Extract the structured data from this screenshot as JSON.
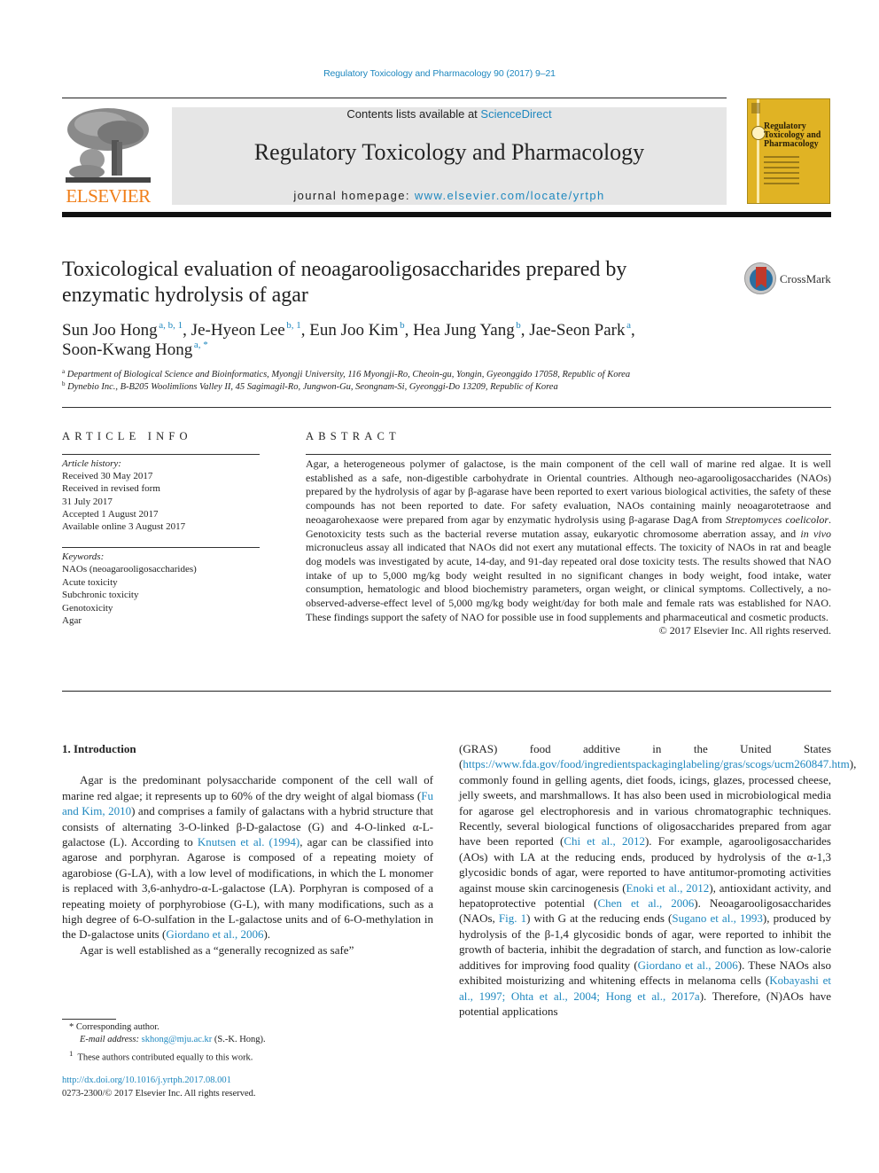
{
  "running_head": "Regulatory Toxicology and Pharmacology 90 (2017) 9–21",
  "header": {
    "publisher": "ELSEVIER",
    "contents_prefix": "Contents lists available at ",
    "contents_link": "ScienceDirect",
    "journal_name": "Regulatory Toxicology and Pharmacology",
    "homepage_prefix": "journal homepage: ",
    "homepage_link": "www.elsevier.com/locate/yrtph",
    "cover_title_lines": [
      "Regulatory",
      "Toxicology and",
      "Pharmacology"
    ],
    "cover_color": "#e0b324"
  },
  "crossmark": {
    "label": "CrossMark",
    "icon": "crossmark-icon"
  },
  "article": {
    "title": "Toxicological evaluation of neoagarooligosaccharides prepared by enzymatic hydrolysis of agar",
    "authors": [
      {
        "name": "Sun Joo Hong",
        "sup": "a, b, 1",
        "sep": ", "
      },
      {
        "name": "Je-Hyeon Lee",
        "sup": "b, 1",
        "sep": ", "
      },
      {
        "name": "Eun Joo Kim",
        "sup": "b",
        "sep": ", "
      },
      {
        "name": "Hea Jung Yang",
        "sup": "b",
        "sep": ", "
      },
      {
        "name": "Jae-Seon Park",
        "sup": "a",
        "sep": ","
      },
      {
        "name": "Soon-Kwang Hong",
        "sup": "a, *",
        "sep": ""
      }
    ],
    "affiliations": [
      {
        "key": "a",
        "text": "Department of Biological Science and Bioinformatics, Myongji University, 116 Myongji-Ro, Cheoin-gu, Yongin, Gyeonggido 17058, Republic of Korea"
      },
      {
        "key": "b",
        "text": "Dynebio Inc., B-B205 Woolimlions Valley II, 45 Sagimagil-Ro, Jungwon-Gu, Seongnam-Si, Gyeonggi-Do 13209, Republic of Korea"
      }
    ]
  },
  "article_info": {
    "heading": "ARTICLE INFO",
    "history_label": "Article history:",
    "history": [
      "Received 30 May 2017",
      "Received in revised form",
      "31 July 2017",
      "Accepted 1 August 2017",
      "Available online 3 August 2017"
    ],
    "keywords_label": "Keywords:",
    "keywords": [
      "NAOs (neoagarooligosaccharides)",
      "Acute toxicity",
      "Subchronic toxicity",
      "Genotoxicity",
      "Agar"
    ]
  },
  "abstract": {
    "heading": "ABSTRACT",
    "part1": "Agar, a heterogeneous polymer of galactose, is the main component of the cell wall of marine red algae. It is well established as a safe, non-digestible carbohydrate in Oriental countries. Although neo-agarooligosaccharides (NAOs) prepared by the hydrolysis of agar by β-agarase have been reported to exert various biological activities, the safety of these compounds has not been reported to date. For safety evaluation, NAOs containing mainly neoagarotetraose and neoagarohexaose were prepared from agar by enzymatic hydrolysis using β-agarase DagA from ",
    "species": "Streptomyces coelicolor",
    "part2": ". Genotoxicity tests such as the bacterial reverse mutation assay, eukaryotic chromosome aberration assay, and ",
    "in_vivo": "in vivo",
    "part3": " micronucleus assay all indicated that NAOs did not exert any mutational effects. The toxicity of NAOs in rat and beagle dog models was investigated by acute, 14-day, and 91-day repeated oral dose toxicity tests. The results showed that NAO intake of up to 5,000 mg/kg body weight resulted in no significant changes in body weight, food intake, water consumption, hematologic and blood biochemistry parameters, organ weight, or clinical symptoms. Collectively, a no-observed-adverse-effect level of 5,000 mg/kg body weight/day for both male and female rats was established for NAO. These findings support the safety of NAO for possible use in food supplements and pharmaceutical and cosmetic products.",
    "copyright": "© 2017 Elsevier Inc. All rights reserved."
  },
  "intro": {
    "heading": "1.  Introduction",
    "left_p1": [
      {
        "t": "Agar is the predominant polysaccharide component of the cell wall of marine red algae; it represents up to 60% of the dry weight of algal biomass ("
      },
      {
        "l": "Fu and Kim, 2010"
      },
      {
        "t": ") and comprises a family of galactans with a hybrid structure that consists of alternating 3-O-linked β-D-galactose (G) and 4-O-linked α-L-galactose (L). According to "
      },
      {
        "l": "Knutsen et al. (1994)"
      },
      {
        "t": ", agar can be classified into agarose and porphyran. Agarose is composed of a repeating moiety of agarobiose (G-LA), with a low level of modifications, in which the L monomer is replaced with 3,6-anhydro-α-L-galactose (LA). Porphyran is composed of a repeating moiety of porphyrobiose (G-L), with many modifications, such as a high degree of 6-O-sulfation in the L-galactose units and of 6-O-methylation in the D-galactose units ("
      },
      {
        "l": "Giordano et al., 2006"
      },
      {
        "t": ")."
      }
    ],
    "left_p2": "Agar is well established as a “generally recognized as safe”",
    "right_p1": [
      {
        "t": "(GRAS) food additive in the United States ("
      },
      {
        "l": "https://www.fda.gov/food/ingredientspackaginglabeling/gras/scogs/ucm260847.htm"
      },
      {
        "t": "), commonly found in gelling agents, diet foods, icings, glazes, processed cheese, jelly sweets, and marshmallows. It has also been used in microbiological media for agarose gel electrophoresis and in various chromatographic techniques. Recently, several biological functions of oligosaccharides prepared from agar have been reported ("
      },
      {
        "l": "Chi et al., 2012"
      },
      {
        "t": "). For example, agarooligosaccharides (AOs) with LA at the reducing ends, produced by hydrolysis of the α-1,3 glycosidic bonds of agar, were reported to have antitumor-promoting activities against mouse skin carcinogenesis ("
      },
      {
        "l": "Enoki et al., 2012"
      },
      {
        "t": "), antioxidant activity, and hepatoprotective potential ("
      },
      {
        "l": "Chen et al., 2006"
      },
      {
        "t": "). Neoagarooligosaccharides (NAOs, "
      },
      {
        "l": "Fig. 1"
      },
      {
        "t": ") with G at the reducing ends ("
      },
      {
        "l": "Sugano et al., 1993"
      },
      {
        "t": "), produced by hydrolysis of the β-1,4 glycosidic bonds of agar, were reported to inhibit the growth of bacteria, inhibit the degradation of starch, and function as low-calorie additives for improving food quality ("
      },
      {
        "l": "Giordano et al., 2006"
      },
      {
        "t": "). These NAOs also exhibited moisturizing and whitening effects in melanoma cells ("
      },
      {
        "l": "Kobayashi et al., 1997; Ohta et al., 2004; Hong et al., 2017a"
      },
      {
        "t": "). Therefore, (N)AOs have potential applications"
      }
    ]
  },
  "footnotes": {
    "corresponding": "*  Corresponding author.",
    "email_label": "E-mail address:",
    "email": "skhong@mju.ac.kr",
    "email_suffix": " (S.-K. Hong).",
    "equal": "These authors contributed equally to this work.",
    "equal_mark": "1",
    "doi": "http://dx.doi.org/10.1016/j.yrtph.2017.08.001",
    "issn": "0273-2300/© 2017 Elsevier Inc. All rights reserved."
  },
  "colors": {
    "link": "#1f88bf",
    "elsevier_orange": "#f07f1a",
    "masthead_bg": "#e6e6e6"
  }
}
